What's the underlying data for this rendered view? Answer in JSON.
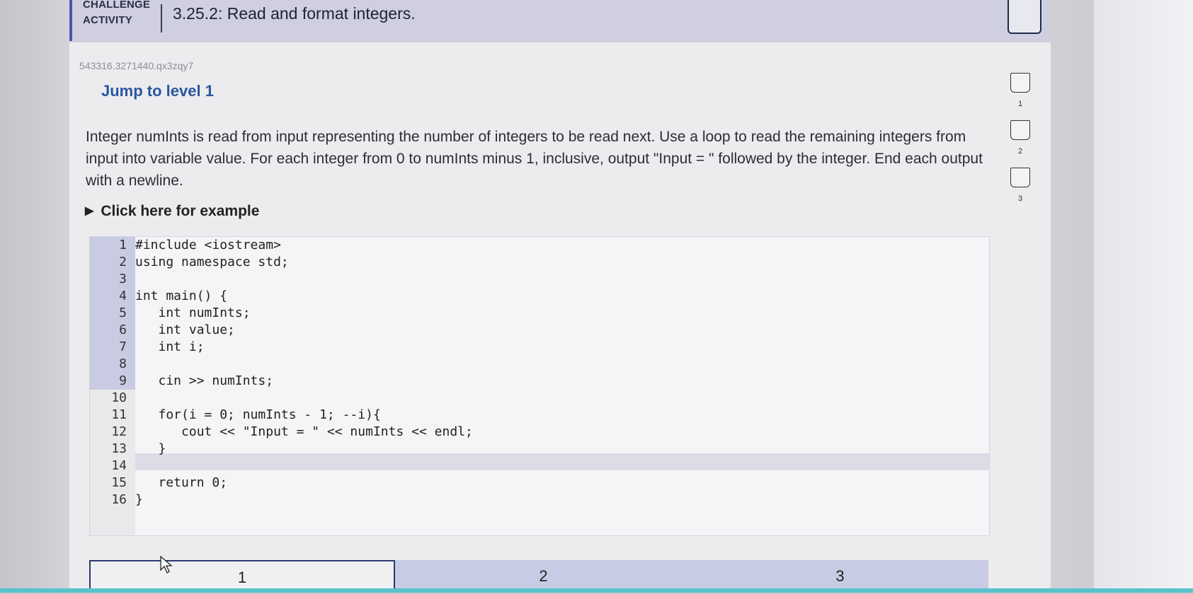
{
  "header": {
    "challenge_label_line1": "CHALLENGE",
    "challenge_label_line2": "ACTIVITY",
    "title": "3.25.2: Read and format integers."
  },
  "challenge_id": "543316.3271440.qx3zqy7",
  "jump_level": "Jump to level 1",
  "prompt": "Integer numInts is read from input representing the number of integers to be read next. Use a loop to read the remaining integers from input into variable value. For each integer from 0 to numInts minus 1, inclusive, output \"Input = \" followed by the integer. End each output with a newline.",
  "example_toggle": "Click here for example",
  "example_icon": "triangle-right-icon",
  "levels_side": [
    "1",
    "2",
    "3"
  ],
  "code_lines": [
    {
      "n": "1",
      "text": "#include <iostream>"
    },
    {
      "n": "2",
      "text": "using namespace std;"
    },
    {
      "n": "3",
      "text": ""
    },
    {
      "n": "4",
      "text": "int main() {"
    },
    {
      "n": "5",
      "text": "   int numInts;"
    },
    {
      "n": "6",
      "text": "   int value;"
    },
    {
      "n": "7",
      "text": "   int i;"
    },
    {
      "n": "8",
      "text": ""
    },
    {
      "n": "9",
      "text": "   cin >> numInts;"
    },
    {
      "n": "10",
      "text": ""
    },
    {
      "n": "11",
      "text": "   for(i = 0; numInts - 1; --i){"
    },
    {
      "n": "12",
      "text": "      cout << \"Input = \" << numInts << endl;"
    },
    {
      "n": "13",
      "text": "   }"
    },
    {
      "n": "14",
      "text": ""
    },
    {
      "n": "15",
      "text": "   return 0;"
    },
    {
      "n": "16",
      "text": "}"
    }
  ],
  "level_tabs": [
    "1",
    "2",
    "3"
  ],
  "colors": {
    "accent": "#2a56a0",
    "header_bg": "#cfcfe0",
    "gutter_highlight": "#c9cbe3",
    "tab_bg": "#c8cbe4",
    "bottom_strip": "#59c2cc"
  }
}
